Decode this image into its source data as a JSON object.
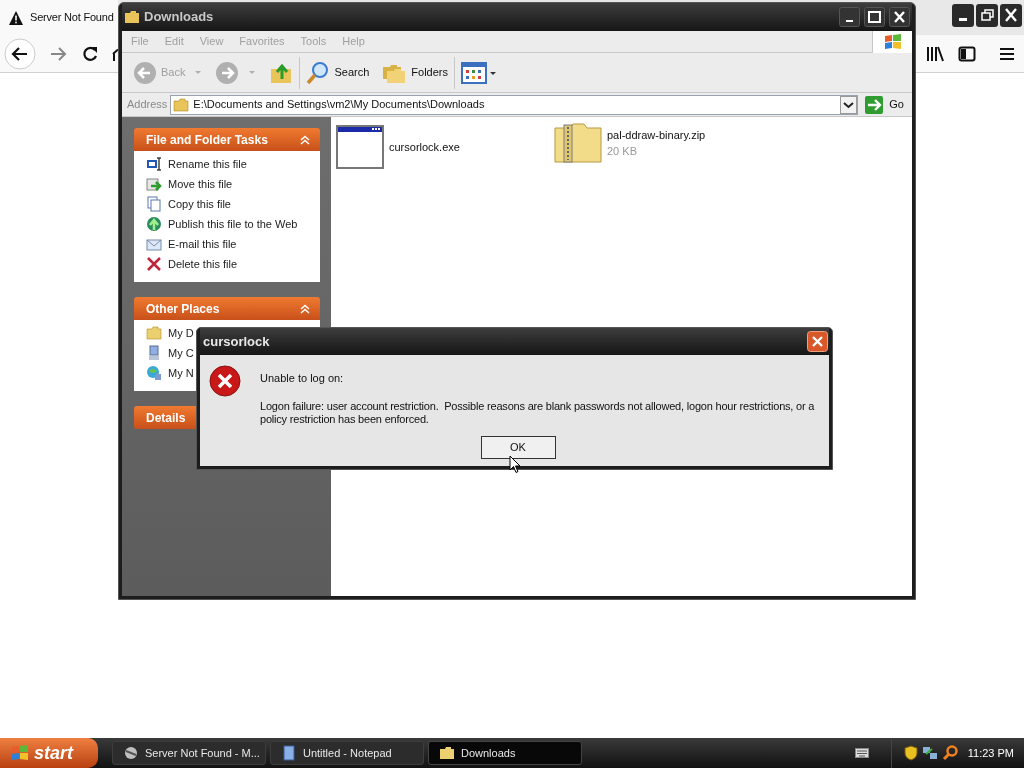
{
  "browser": {
    "tab": {
      "title": "Server Not Found",
      "selected": true
    }
  },
  "explorer": {
    "title": "Downloads",
    "menu": [
      "File",
      "Edit",
      "View",
      "Favorites",
      "Tools",
      "Help"
    ],
    "toolbar": [
      {
        "kind": "back",
        "label": "Back",
        "disabled": true
      },
      {
        "kind": "forward",
        "disabled": true
      },
      {
        "kind": "up"
      },
      {
        "kind": "search",
        "label": "Search"
      },
      {
        "kind": "folders",
        "label": "Folders"
      },
      {
        "kind": "views"
      }
    ],
    "address": {
      "label": "Address",
      "value": "E:\\Documents and Settings\\vm2\\My Documents\\Downloads",
      "go": "Go"
    },
    "task_panels": [
      {
        "title": "File and Folder Tasks",
        "expanded": true,
        "items": [
          {
            "label": "Rename this file",
            "kind": "rename"
          },
          {
            "label": "Move this file",
            "kind": "move"
          },
          {
            "label": "Copy this file",
            "kind": "copy"
          },
          {
            "label": "Publish this file to the Web",
            "kind": "publish"
          },
          {
            "label": "E-mail this file",
            "kind": "email"
          },
          {
            "label": "Delete this file",
            "kind": "delete"
          }
        ]
      },
      {
        "title": "Other Places",
        "expanded": true,
        "items": [
          {
            "label": "My D",
            "kind": "folder"
          },
          {
            "label": "My C",
            "kind": "computer"
          },
          {
            "label": "My N",
            "kind": "network"
          }
        ]
      },
      {
        "title": "Details",
        "expanded": false
      }
    ],
    "files": [
      {
        "name": "cursorlock.exe",
        "kind": "exe"
      },
      {
        "name": "pal-ddraw-binary.zip",
        "size": "20 KB",
        "kind": "zip"
      }
    ]
  },
  "dialog": {
    "title": "cursorlock",
    "heading": "Unable to log on:",
    "message": "Logon failure: user account restriction.  Possible reasons are blank passwords not allowed, logon hour restrictions, or a policy restriction has been enforced.",
    "button": "OK"
  },
  "taskbar": {
    "start": "start",
    "tasks": [
      {
        "label": "Server Not Found - M...",
        "kind": "browser",
        "selected": false
      },
      {
        "label": "Untitled - Notepad",
        "kind": "notepad",
        "selected": false
      },
      {
        "label": "Downloads",
        "kind": "folder",
        "selected": true
      }
    ],
    "clock": "11:23 PM"
  }
}
